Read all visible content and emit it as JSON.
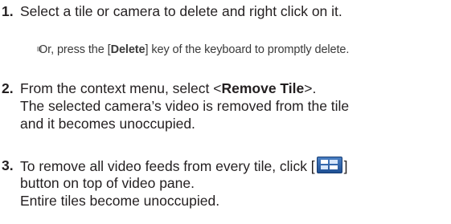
{
  "steps": [
    {
      "number": "1.",
      "lines": [
        "Select a tile or camera to delete and right click on it."
      ]
    },
    {
      "number": "2.",
      "line1_prefix": "From the context menu, select <",
      "line1_bold": "Remove Tile",
      "line1_suffix": ">.",
      "lines": [
        "The selected camera’s video is removed from the tile",
        "and it becomes unoccupied."
      ]
    },
    {
      "number": "3.",
      "line1_prefix": "To remove all video feeds from every tile, click [",
      "line1_suffix": "]",
      "lines": [
        "button on top of video pane.",
        "Entire tiles become unoccupied."
      ],
      "icon": "clear-all-tiles-icon"
    }
  ],
  "note": {
    "prefix": "Or, press the [",
    "bold": "Delete",
    "suffix": "] key of the keyboard to promptly delete."
  }
}
